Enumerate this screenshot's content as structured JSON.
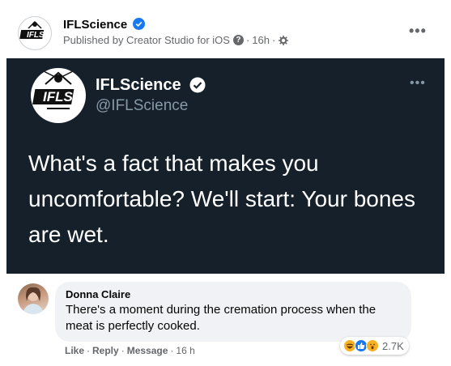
{
  "header": {
    "page_name": "IFLScience",
    "published_by": "Published by Creator Studio for iOS",
    "info_glyph": "?",
    "separator": "·",
    "time": "16h",
    "more_label": "•••",
    "avatar_text": "IFLS"
  },
  "tweet": {
    "name": "IFLScience",
    "handle": "@IFLScience",
    "text": "What's a fact that makes you uncomfortable? We'll start: Your bones are wet.",
    "more_label": "•••",
    "avatar_text": "IFLS",
    "background": "#15202b"
  },
  "comment": {
    "author": "Donna Claire",
    "text": "There's a moment during the cremation process when the meat is perfectly cooked.",
    "reaction_count": "2.7K",
    "actions": {
      "like": "Like",
      "reply": "Reply",
      "message": "Message",
      "time": "16 h",
      "separator": "·"
    }
  },
  "colors": {
    "accent": "#1877f2",
    "meta_gray": "#65676b"
  }
}
